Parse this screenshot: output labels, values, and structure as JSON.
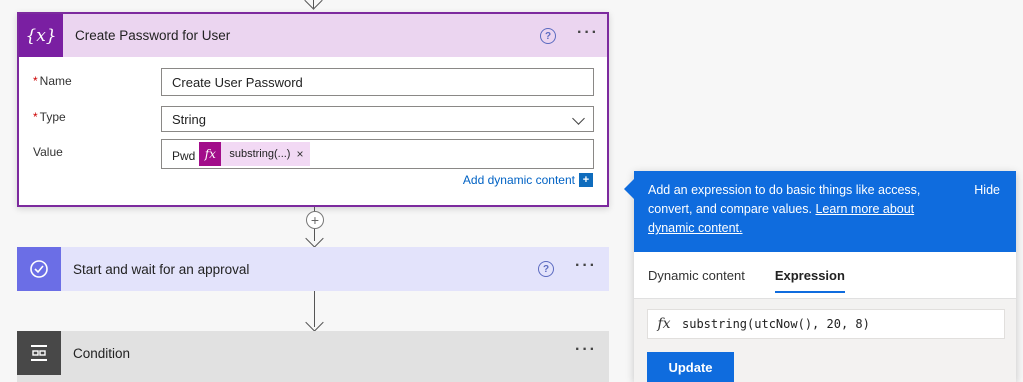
{
  "variable_card": {
    "title": "Create Password for User",
    "help": "?",
    "more": "···",
    "fields": {
      "name": {
        "required_mark": "*",
        "label": "Name",
        "value": "Create User Password"
      },
      "type": {
        "required_mark": "*",
        "label": "Type",
        "value": "String"
      },
      "value": {
        "label": "Value",
        "prefix_text": "Pwd",
        "token_label": "substring(...)",
        "token_remove": "×"
      }
    },
    "add_dynamic_label": "Add dynamic content",
    "add_dynamic_icon": "+"
  },
  "add_step": "+",
  "approval_card": {
    "title": "Start and wait for an approval",
    "help": "?",
    "more": "···"
  },
  "condition_card": {
    "title": "Condition",
    "more": "···"
  },
  "popup": {
    "banner_text": "Add an expression to do basic things like access, convert, and compare values.",
    "learn_more_link": "Learn more about dynamic content.",
    "hide_label": "Hide",
    "tabs": [
      {
        "label": "Dynamic content",
        "active": false
      },
      {
        "label": "Expression",
        "active": true
      }
    ],
    "expression_value": "substring(utcNow(), 20, 8)",
    "fx_symbol": "fx",
    "update_label": "Update"
  },
  "colors": {
    "variable_accent": "#7a1fa2",
    "approval_accent": "#6b6ee6",
    "condition_accent": "#484848",
    "popup_blue": "#0f6cde"
  }
}
